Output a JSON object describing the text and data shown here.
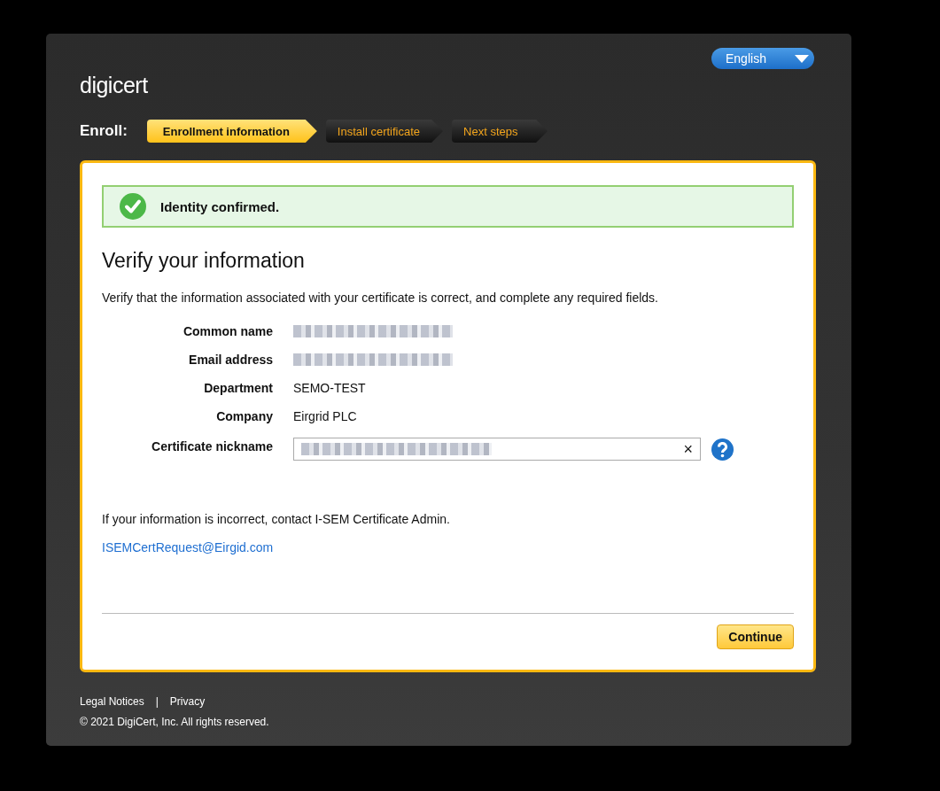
{
  "logo": "digicert",
  "language": {
    "value": "English"
  },
  "steps": {
    "label": "Enroll:",
    "items": [
      {
        "label": "Enrollment information",
        "selected": true
      },
      {
        "label": "Install certificate",
        "selected": false
      },
      {
        "label": "Next steps",
        "selected": false
      }
    ]
  },
  "banner": {
    "text": "Identity confirmed."
  },
  "heading": "Verify your information",
  "intro": "Verify that the information associated with your certificate is correct, and complete any required fields.",
  "fields": [
    {
      "label": "Common name",
      "kind": "redacted"
    },
    {
      "label": "Email address",
      "kind": "redacted"
    },
    {
      "label": "Department",
      "kind": "text",
      "value": "SEMO-TEST"
    },
    {
      "label": "Company",
      "kind": "text",
      "value": "Eirgrid PLC"
    },
    {
      "label": "Certificate nickname",
      "kind": "input",
      "clear": "×"
    }
  ],
  "contact_note": "If your information is incorrect, contact I-SEM Certificate Admin.",
  "contact_email": "ISEMCertRequest@Eirgid.com",
  "continue_button": "Continue",
  "footer": {
    "links": [
      "Legal Notices",
      "Privacy"
    ],
    "separator": "|",
    "copyright": "© 2021 DigiCert, Inc. All rights reserved."
  }
}
